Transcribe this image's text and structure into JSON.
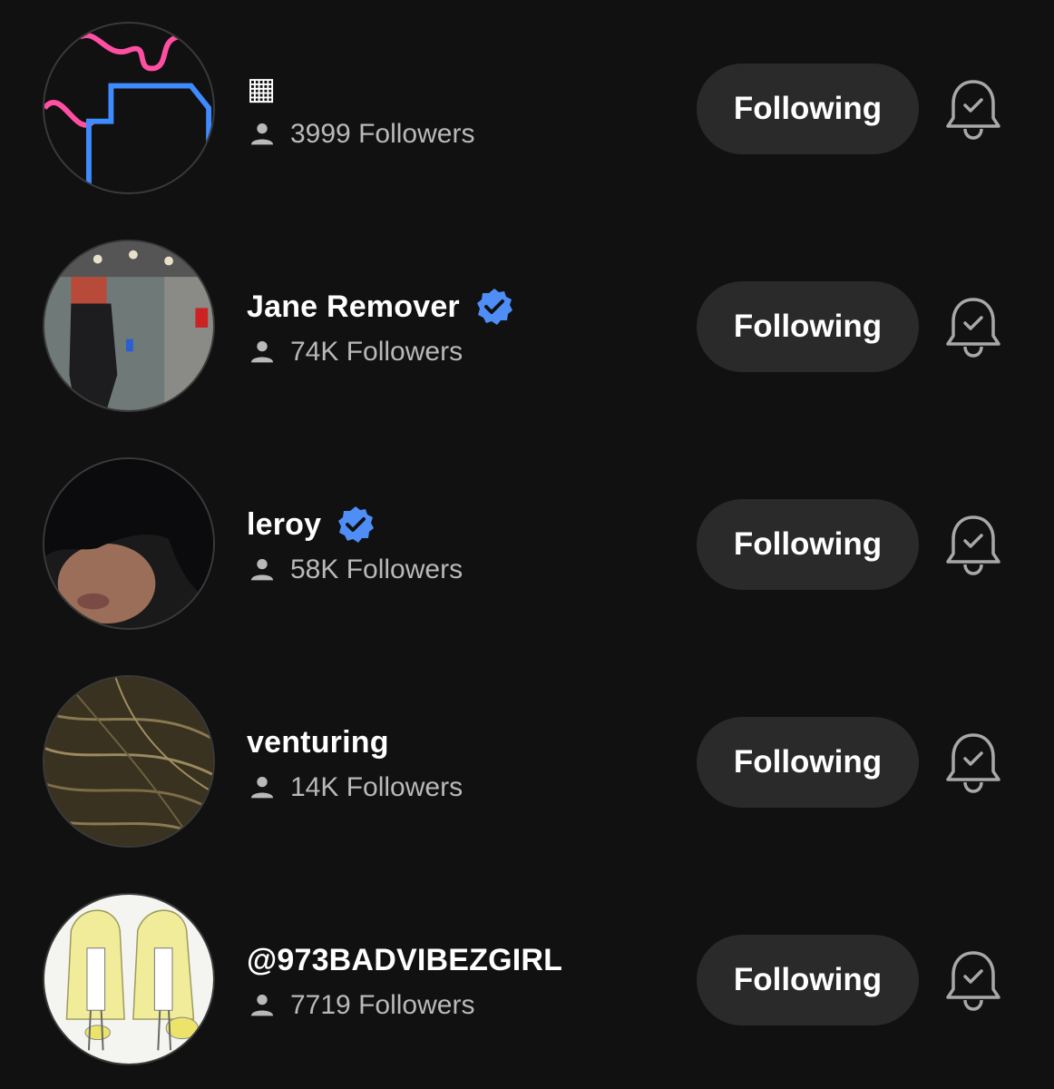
{
  "accounts": [
    {
      "name": "▦",
      "followers": "3999 Followers",
      "verified": false,
      "button_label": "Following",
      "avatar": "neon-outline-shapes-avatar"
    },
    {
      "name": "Jane Remover",
      "followers": "74K Followers",
      "verified": true,
      "button_label": "Following",
      "avatar": "elevator-mirror-selfie-avatar"
    },
    {
      "name": "leroy",
      "followers": "58K Followers",
      "verified": true,
      "button_label": "Following",
      "avatar": "dark-hair-portrait-avatar"
    },
    {
      "name": "venturing",
      "followers": "14K Followers",
      "verified": false,
      "button_label": "Following",
      "avatar": "dry-grass-avatar"
    },
    {
      "name": "@973BADVIBEZGIRL",
      "followers": "7719 Followers",
      "verified": false,
      "button_label": "Following",
      "avatar": "character-sketch-sheet-avatar"
    }
  ],
  "colors": {
    "background": "#111111",
    "button": "#2a2a2a",
    "verified": "#4f8ef7",
    "secondary_text": "#b9b9b9"
  }
}
